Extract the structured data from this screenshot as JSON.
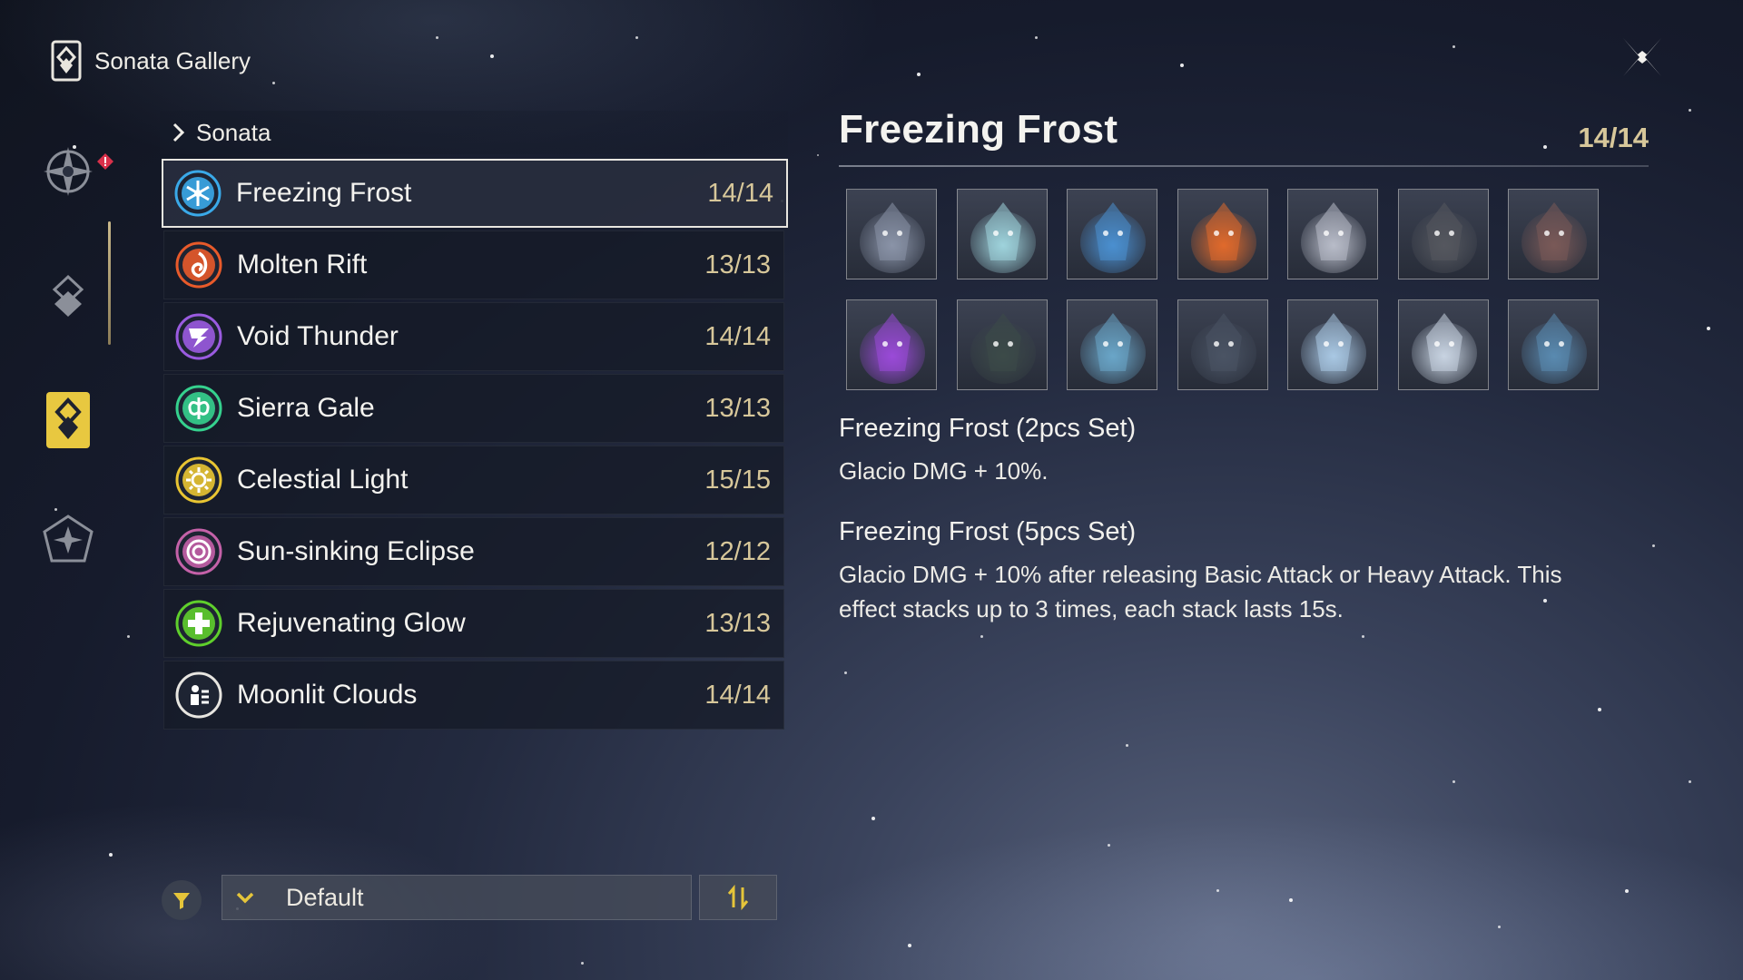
{
  "header": {
    "title": "Sonata Gallery"
  },
  "sidenav": {
    "items": [
      {
        "name": "echo-gallery",
        "icon": "compass-star-icon",
        "has_alert": true
      },
      {
        "name": "echo-records",
        "icon": "stacked-diamond-icon",
        "has_alert": false
      },
      {
        "name": "sonata-gallery",
        "icon": "sonata-card-icon",
        "active": true
      },
      {
        "name": "echo-codex",
        "icon": "crystal-star-icon",
        "has_alert": false
      }
    ]
  },
  "breadcrumb": {
    "label": "Sonata"
  },
  "sets": [
    {
      "name": "Freezing Frost",
      "count": "14/14",
      "color": "#3aa9e8",
      "icon": "snowflake-icon",
      "selected": true
    },
    {
      "name": "Molten Rift",
      "count": "13/13",
      "color": "#e85a2a",
      "icon": "flame-swirl-icon"
    },
    {
      "name": "Void Thunder",
      "count": "14/14",
      "color": "#9a5be0",
      "icon": "thunder-swirl-icon"
    },
    {
      "name": "Sierra Gale",
      "count": "13/13",
      "color": "#35d18e",
      "icon": "wind-wings-icon"
    },
    {
      "name": "Celestial Light",
      "count": "15/15",
      "color": "#e9c532",
      "icon": "sun-icon"
    },
    {
      "name": "Sun-sinking Eclipse",
      "count": "12/12",
      "color": "#c461a8",
      "icon": "spiral-icon"
    },
    {
      "name": "Rejuvenating Glow",
      "count": "13/13",
      "color": "#5fcf2c",
      "icon": "heal-cross-icon"
    },
    {
      "name": "Moonlit Clouds",
      "count": "14/14",
      "color": "#e7e5e0",
      "icon": "cloud-person-icon"
    }
  ],
  "filter": {
    "sort_value": "Default"
  },
  "detail": {
    "title": "Freezing Frost",
    "count": "14/14",
    "echoes": [
      {
        "name": "echo-1",
        "tint": "#8a94a8"
      },
      {
        "name": "echo-2",
        "tint": "#9fd3dc"
      },
      {
        "name": "echo-3",
        "tint": "#4a8fd0"
      },
      {
        "name": "echo-4",
        "tint": "#e06a2c"
      },
      {
        "name": "echo-5",
        "tint": "#b8bcc8"
      },
      {
        "name": "echo-6",
        "tint": "#55585f"
      },
      {
        "name": "echo-7",
        "tint": "#7a5a58"
      },
      {
        "name": "echo-8",
        "tint": "#9a4ad8"
      },
      {
        "name": "echo-9",
        "tint": "#3c4a48"
      },
      {
        "name": "echo-10",
        "tint": "#6aa6c8"
      },
      {
        "name": "echo-11",
        "tint": "#4a5464"
      },
      {
        "name": "echo-12",
        "tint": "#a9c8e4"
      },
      {
        "name": "echo-13",
        "tint": "#c8d4e2"
      },
      {
        "name": "echo-14",
        "tint": "#5a8ab0"
      }
    ],
    "effects": [
      {
        "title": "Freezing Frost (2pcs Set)",
        "desc": "Glacio DMG + 10%."
      },
      {
        "title": "Freezing Frost (5pcs Set)",
        "desc": "Glacio DMG + 10% after releasing Basic Attack or Heavy Attack. This effect stacks up to 3 times, each stack lasts 15s."
      }
    ]
  }
}
